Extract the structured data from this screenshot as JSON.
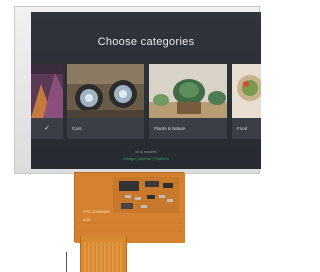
{
  "screen": {
    "title": "Choose categories",
    "categories": [
      {
        "label": ""
      },
      {
        "label": "Cars"
      },
      {
        "label": "Plants & Nature"
      },
      {
        "label": "Food"
      }
    ],
    "selected_mark": "✓",
    "footer_line1": "or & models",
    "footer_line2": "Design | Interior | Fashion"
  },
  "fpc": {
    "part_number": "FPC-70002MH",
    "code": "A40"
  },
  "colors": {
    "screen_bg": "#2b2f36",
    "accent_green": "#2fa866",
    "fpc_orange": "#d4822f"
  }
}
